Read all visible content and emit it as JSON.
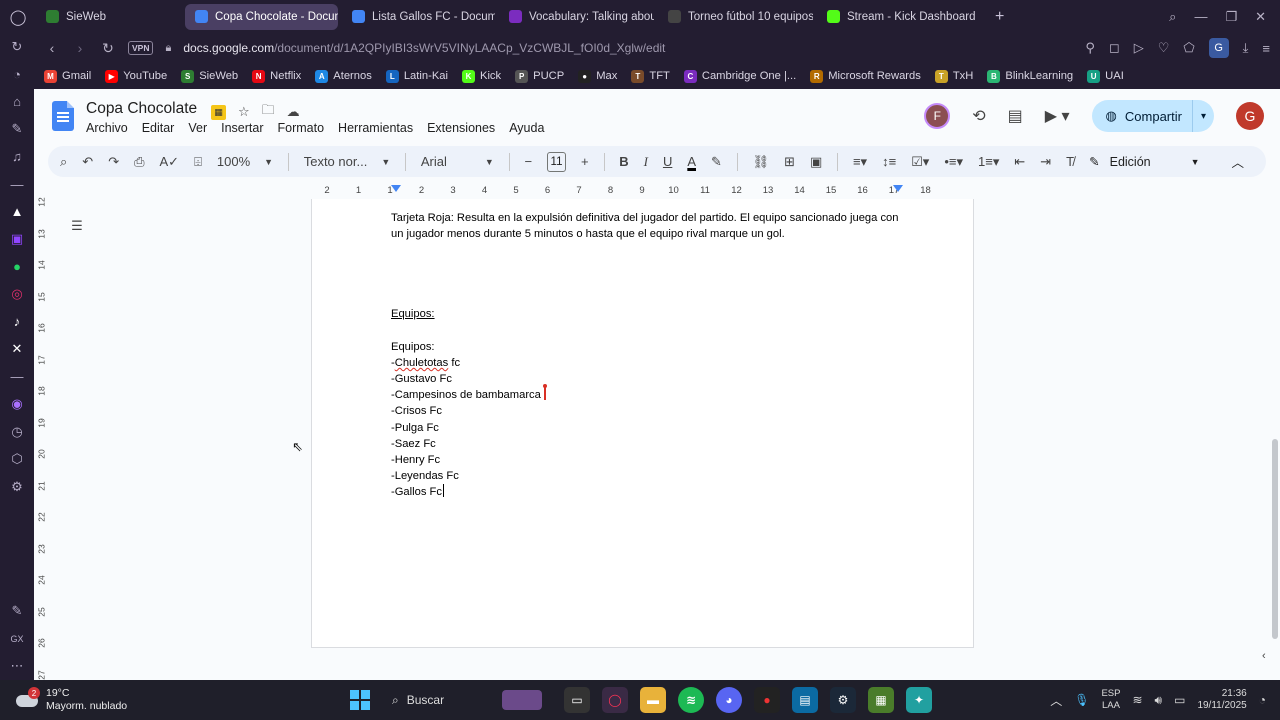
{
  "browser": {
    "tabs": [
      {
        "label": "SieWeb",
        "icon": "sieweb-icon",
        "active": false,
        "color": "#2e7d32"
      },
      {
        "label": "Copa Chocolate - Docum",
        "icon": "docs-icon",
        "active": true,
        "color": "#4285f4"
      },
      {
        "label": "Lista Gallos FC - Docume",
        "icon": "docs-icon",
        "active": false,
        "color": "#4285f4"
      },
      {
        "label": "Vocabulary: Talking abou",
        "icon": "cambridge-icon",
        "active": false,
        "color": "#7b2cbf"
      },
      {
        "label": "Torneo fútbol 10 equipos",
        "icon": "openai-icon",
        "active": false,
        "color": "#444"
      },
      {
        "label": "Stream - Kick Dashboard",
        "icon": "kick-icon",
        "active": false,
        "color": "#53fc18"
      }
    ],
    "url_domain": "docs.google.com",
    "url_path": "/document/d/1A2QPIyIBI3sWrV5VINyLAACp_VzCWBJL_fOI0d_Xglw/edit",
    "vpn_label": "VPN",
    "profile_letter": "G",
    "bookmarks": [
      {
        "label": "Gmail",
        "color": "#ea4335",
        "glyph": "M"
      },
      {
        "label": "YouTube",
        "color": "#ff0000",
        "glyph": "▶"
      },
      {
        "label": "SieWeb",
        "color": "#2e7d32",
        "glyph": "S"
      },
      {
        "label": "Netflix",
        "color": "#e50914",
        "glyph": "N"
      },
      {
        "label": "Aternos",
        "color": "#1e88e5",
        "glyph": "A"
      },
      {
        "label": "Latin-Kai",
        "color": "#1565c0",
        "glyph": "L"
      },
      {
        "label": "Kick",
        "color": "#53fc18",
        "glyph": "K"
      },
      {
        "label": "PUCP",
        "color": "#555",
        "glyph": "P"
      },
      {
        "label": "Max",
        "color": "#222",
        "glyph": "●"
      },
      {
        "label": "TFT",
        "color": "#7a4b2a",
        "glyph": "T"
      },
      {
        "label": "Cambridge One |...",
        "color": "#7b2cbf",
        "glyph": "C"
      },
      {
        "label": "Microsoft Rewards",
        "color": "#b36b00",
        "glyph": "R"
      },
      {
        "label": "TxH",
        "color": "#c9a227",
        "glyph": "T"
      },
      {
        "label": "BlinkLearning",
        "color": "#2bb673",
        "glyph": "B"
      },
      {
        "label": "UAI",
        "color": "#16a085",
        "glyph": "U"
      }
    ]
  },
  "docs": {
    "title": "Copa Chocolate",
    "menus": [
      "Archivo",
      "Editar",
      "Ver",
      "Insertar",
      "Formato",
      "Herramientas",
      "Extensiones",
      "Ayuda"
    ],
    "collaborator_letter": "F",
    "share_label": "Compartir",
    "user_letter": "G",
    "toolbar": {
      "zoom": "100%",
      "style": "Texto nor...",
      "font": "Arial",
      "font_size": "11",
      "mode": "Edición"
    },
    "ruler_numbers": [
      "2",
      "1",
      "1",
      "2",
      "3",
      "4",
      "5",
      "6",
      "7",
      "8",
      "9",
      "10",
      "11",
      "12",
      "13",
      "14",
      "15",
      "16",
      "17",
      "18"
    ],
    "vruler_numbers": [
      "12",
      "13",
      "14",
      "15",
      "16",
      "17",
      "18",
      "19",
      "20",
      "21",
      "22",
      "23",
      "24",
      "25",
      "26",
      "27"
    ],
    "content": {
      "paragraph": "Tarjeta Roja: Resulta en la expulsión definitiva del jugador del partido. El equipo sancionado juega con un jugador menos durante 5 minutos o hasta que el equipo rival marque un gol.",
      "heading": "Equipos:",
      "teams_title": "Equipos:",
      "teams": [
        {
          "dash": "-",
          "name": "Chuletotas",
          "suffix": " fc"
        },
        {
          "dash": "-",
          "name": "Gustavo Fc",
          "suffix": ""
        },
        {
          "dash": "-",
          "name": "Campesinos de bambamarca",
          "suffix": ""
        },
        {
          "dash": "-",
          "name": "Crisos Fc",
          "suffix": ""
        },
        {
          "dash": "-",
          "name": "Pulga Fc",
          "suffix": ""
        },
        {
          "dash": "-",
          "name": "Saez Fc",
          "suffix": ""
        },
        {
          "dash": "-",
          "name": "Henry Fc",
          "suffix": ""
        },
        {
          "dash": "-",
          "name": "Leyendas Fc",
          "suffix": ""
        },
        {
          "dash": "-",
          "name": "Gallos Fc",
          "suffix": ""
        }
      ]
    }
  },
  "taskbar": {
    "weather_temp": "19°C",
    "weather_desc": "Mayorm. nublado",
    "weather_badge": "2",
    "search_placeholder": "Buscar",
    "lang_top": "ESP",
    "lang_bottom": "LAA",
    "time": "21:36",
    "date": "19/11/2025"
  }
}
